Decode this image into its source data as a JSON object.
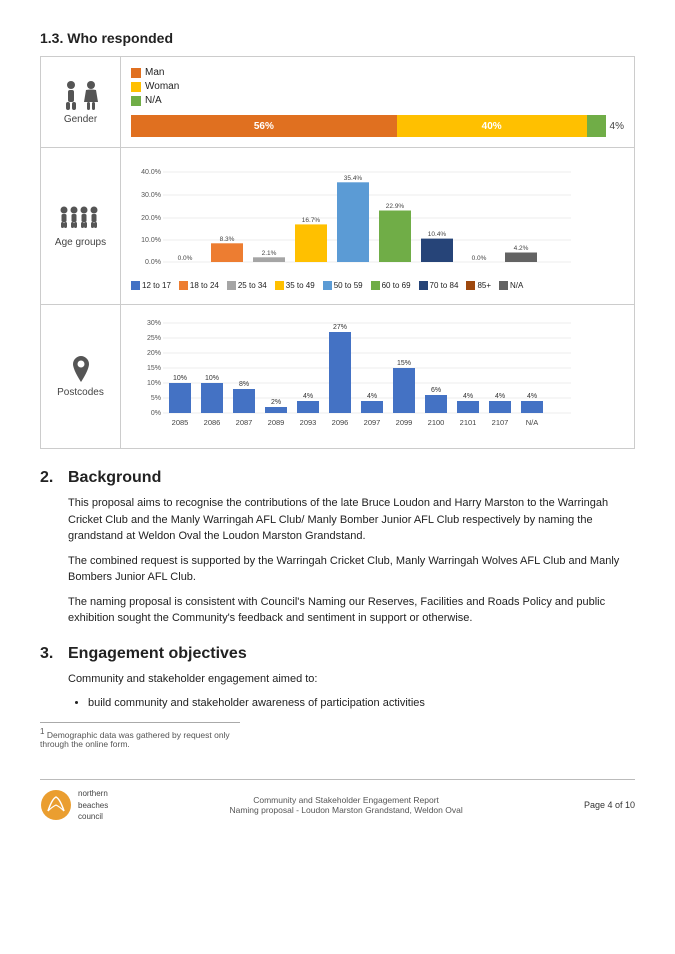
{
  "page": {
    "section_1_3": {
      "title": "1.3.  Who responded",
      "footnote_sup": "1"
    },
    "gender": {
      "label": "Gender",
      "legend": [
        {
          "key": "man",
          "label": "Man",
          "color": "#E07020"
        },
        {
          "key": "woman",
          "label": "Woman",
          "color": "#FFC000"
        },
        {
          "key": "na",
          "label": "N/A",
          "color": "#5B9BD5"
        }
      ],
      "bars": [
        {
          "label": "Man",
          "value": 56,
          "pct": "56%",
          "color": "#E07020"
        },
        {
          "label": "Woman",
          "value": 40,
          "pct": "40%",
          "color": "#FFC000"
        },
        {
          "label": "N/A",
          "value": 4,
          "pct": "4%",
          "color": "#70AD47"
        }
      ],
      "na_outside": "4%"
    },
    "age_groups": {
      "label": "Age groups",
      "y_labels": [
        "40.0%",
        "30.0%",
        "20.0%",
        "10.0%",
        "0.0%"
      ],
      "legend": [
        {
          "label": "12 to 17",
          "color": "#4472C4"
        },
        {
          "label": "18 to 24",
          "color": "#ED7D31"
        },
        {
          "label": "25 to 34",
          "color": "#A5A5A5"
        },
        {
          "label": "35 to 49",
          "color": "#FFC000"
        },
        {
          "label": "50 to 59",
          "color": "#5B9BD5"
        },
        {
          "label": "60 to 69",
          "color": "#70AD47"
        },
        {
          "label": "70 to 84",
          "color": "#264478"
        },
        {
          "label": "85+",
          "color": "#9E480E"
        },
        {
          "label": "N/A",
          "color": "#636363"
        }
      ],
      "bars": [
        {
          "group": "12-17",
          "pct": 0.0,
          "label": "0.0%",
          "color": "#4472C4"
        },
        {
          "group": "18-24",
          "pct": 8.3,
          "label": "8.3%",
          "color": "#ED7D31"
        },
        {
          "group": "25-34",
          "pct": 2.1,
          "label": "2.1%",
          "color": "#A5A5A5"
        },
        {
          "group": "35-49",
          "pct": 16.7,
          "label": "16.7%",
          "color": "#FFC000"
        },
        {
          "group": "50-59",
          "pct": 35.4,
          "label": "35.4%",
          "color": "#5B9BD5"
        },
        {
          "group": "60-69",
          "pct": 22.9,
          "label": "22.9%",
          "color": "#70AD47"
        },
        {
          "group": "70-84",
          "pct": 10.4,
          "label": "10.4%",
          "color": "#264478"
        },
        {
          "group": "85+",
          "pct": 0.0,
          "label": "0.0%",
          "color": "#9E480E"
        },
        {
          "group": "N/A",
          "pct": 4.2,
          "label": "4.2%",
          "color": "#636363"
        }
      ]
    },
    "postcodes": {
      "label": "Postcodes",
      "y_labels": [
        "30%",
        "25%",
        "20%",
        "15%",
        "10%",
        "5%",
        "0%"
      ],
      "bars": [
        {
          "code": "2085",
          "pct": 10,
          "label": "10%"
        },
        {
          "code": "2086",
          "pct": 10,
          "label": "10%"
        },
        {
          "code": "2087",
          "pct": 8,
          "label": "8%"
        },
        {
          "code": "2089",
          "pct": 2,
          "label": "2%"
        },
        {
          "code": "2093",
          "pct": 4,
          "label": "4%"
        },
        {
          "code": "2096",
          "pct": 27,
          "label": "27%"
        },
        {
          "code": "2097",
          "pct": 4,
          "label": "4%"
        },
        {
          "code": "2099",
          "pct": 15,
          "label": "15%"
        },
        {
          "code": "2100",
          "pct": 6,
          "label": "6%"
        },
        {
          "code": "2101",
          "pct": 4,
          "label": "4%"
        },
        {
          "code": "2107",
          "pct": 4,
          "label": "4%"
        },
        {
          "code": "N/A",
          "pct": 4,
          "label": "4%"
        }
      ]
    },
    "section2": {
      "number": "2.",
      "title": "Background",
      "paragraphs": [
        "This proposal aims to recognise the contributions of the late Bruce Loudon and Harry Marston to the Warringah Cricket Club and the Manly Warringah AFL Club/ Manly Bomber Junior AFL Club respectively by naming the grandstand at Weldon Oval the Loudon Marston Grandstand.",
        "The combined request is supported by the Warringah Cricket Club, Manly Warringah Wolves AFL Club and Manly Bombers Junior AFL Club.",
        "The naming proposal is consistent with Council's Naming our Reserves, Facilities and Roads Policy and public exhibition sought the Community's feedback and sentiment in support or otherwise."
      ]
    },
    "section3": {
      "number": "3.",
      "title": "Engagement objectives",
      "intro": "Community and stakeholder engagement aimed to:",
      "bullets": [
        "build community and stakeholder awareness of participation activities"
      ]
    },
    "footnote": {
      "sup": "1",
      "text": "Demographic data was gathered by request only through the online form."
    },
    "footer": {
      "logo_text": "northern\nbeaches\ncouncil",
      "center_line1": "Community and Stakeholder Engagement Report",
      "center_line2": "Naming proposal - Loudon Marston Grandstand, Weldon Oval",
      "page": "Page 4 of 10"
    }
  }
}
